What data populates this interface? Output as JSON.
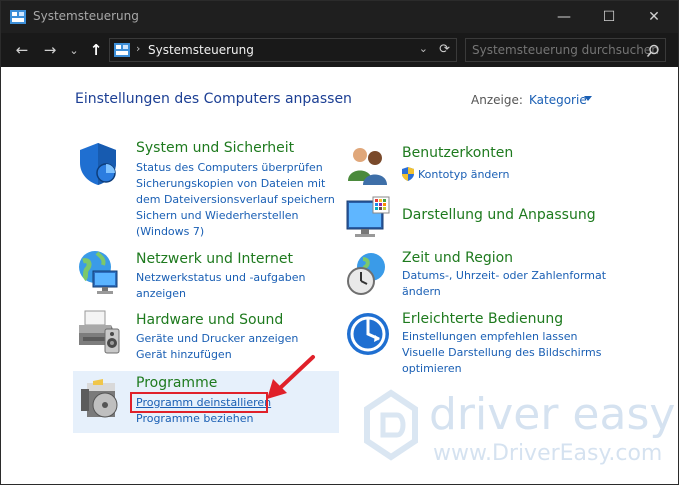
{
  "window": {
    "title": "Systemsteuerung",
    "controls": {
      "minimize": "—",
      "maximize": "☐",
      "close": "✕"
    }
  },
  "nav": {
    "back": "←",
    "forward": "→",
    "recent": "⌄",
    "up": "↑",
    "path_separator": "›",
    "path": "Systemsteuerung",
    "address_dropdown": "⌄",
    "refresh": "⟳",
    "search_placeholder": "Systemsteuerung durchsuchen"
  },
  "main": {
    "heading": "Einstellungen des Computers anpassen",
    "view_label": "Anzeige:",
    "view_value": "Kategorie"
  },
  "categories": {
    "system": {
      "title": "System und Sicherheit",
      "links": [
        "Status des Computers überprüfen",
        "Sicherungskopien von Dateien mit",
        "dem Dateiversionsverlauf speichern",
        "Sichern und Wiederherstellen",
        "(Windows 7)"
      ]
    },
    "network": {
      "title": "Netzwerk und Internet",
      "links": [
        "Netzwerkstatus und -aufgaben",
        "anzeigen"
      ]
    },
    "hardware": {
      "title": "Hardware und Sound",
      "links": [
        "Geräte und Drucker anzeigen",
        "Gerät hinzufügen"
      ]
    },
    "programs": {
      "title": "Programme",
      "links": [
        "Programm deinstallieren",
        "Programme beziehen"
      ]
    },
    "accounts": {
      "title": "Benutzerkonten",
      "links": [
        "Kontotyp ändern"
      ]
    },
    "appearance": {
      "title": "Darstellung und Anpassung",
      "links": []
    },
    "clock": {
      "title": "Zeit und Region",
      "links": [
        "Datums-, Uhrzeit- oder Zahlenformat",
        "ändern"
      ]
    },
    "ease": {
      "title": "Erleichterte Bedienung",
      "links": [
        "Einstellungen empfehlen lassen",
        "Visuelle Darstellung des Bildschirms",
        "optimieren"
      ]
    }
  },
  "watermark": {
    "brand": "driver easy",
    "url": "www.DriverEasy.com"
  },
  "colors": {
    "title_bar": "#1f1f1f",
    "category_title": "#1e7a1e",
    "link": "#1a5fb4",
    "annotation_red": "#e0212a"
  }
}
